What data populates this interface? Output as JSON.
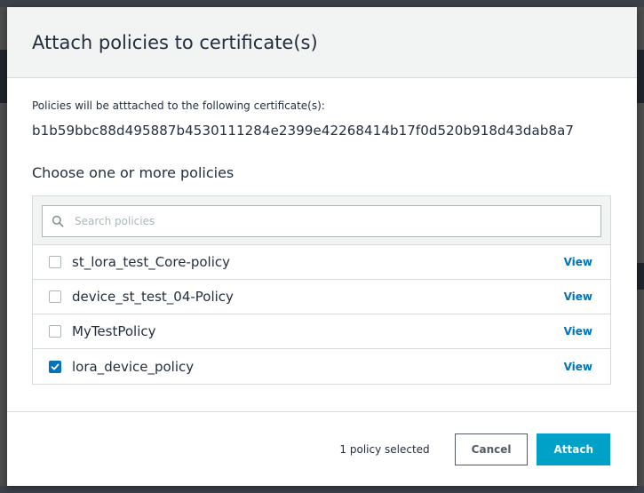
{
  "modal": {
    "title": "Attach policies to certificate(s)",
    "attach_note": "Policies will be atttached to the following certificate(s):",
    "certificate_id": "b1b59bbc88d495887b4530111284e2399e42268414b17f0d520b918d43dab8a7",
    "choose_label": "Choose one or more policies",
    "search": {
      "placeholder": "Search policies"
    },
    "policies": [
      {
        "name": "st_lora_test_Core-policy",
        "checked": false,
        "view_label": "View"
      },
      {
        "name": "device_st_test_04-Policy",
        "checked": false,
        "view_label": "View"
      },
      {
        "name": "MyTestPolicy",
        "checked": false,
        "view_label": "View"
      },
      {
        "name": "lora_device_policy",
        "checked": true,
        "view_label": "View"
      }
    ],
    "footer": {
      "selected_count": "1 policy selected",
      "cancel_label": "Cancel",
      "attach_label": "Attach"
    }
  },
  "colors": {
    "accent": "#0073bb",
    "primary_button": "#00a1c9",
    "header_bg": "#f2f3f3",
    "text": "#232f3e"
  }
}
